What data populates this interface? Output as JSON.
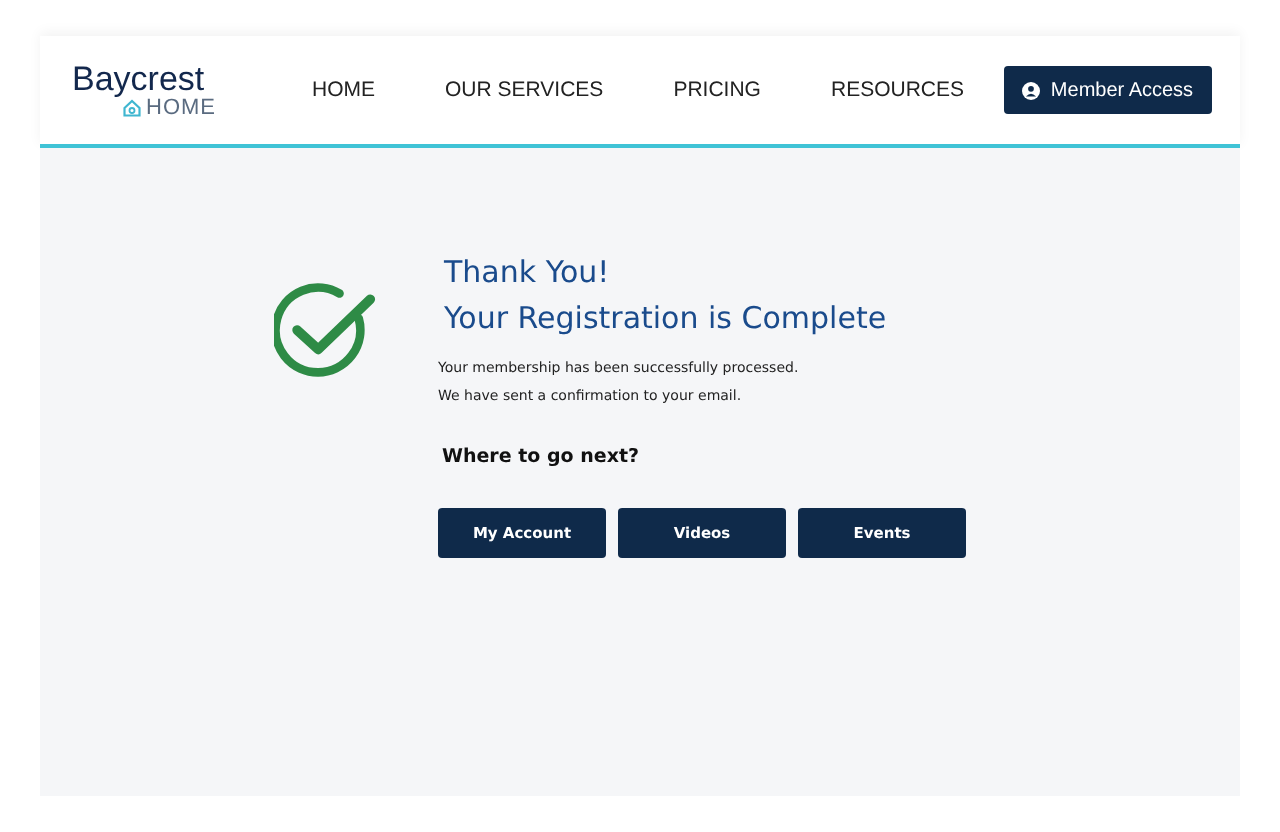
{
  "logo": {
    "name": "Baycrest",
    "sub": "HOME"
  },
  "nav": [
    {
      "label": "HOME"
    },
    {
      "label": "OUR SERVICES"
    },
    {
      "label": "PRICING"
    },
    {
      "label": "RESOURCES"
    }
  ],
  "member_button": "Member Access",
  "confirmation": {
    "title": "Thank You!",
    "subtitle": "Your Registration is Complete",
    "lines": [
      "Your membership has been successfully processed.",
      "We have sent a confirmation to your email."
    ]
  },
  "next": {
    "heading": "Where to go next?",
    "buttons": [
      "My Account",
      "Videos",
      "Events"
    ]
  }
}
